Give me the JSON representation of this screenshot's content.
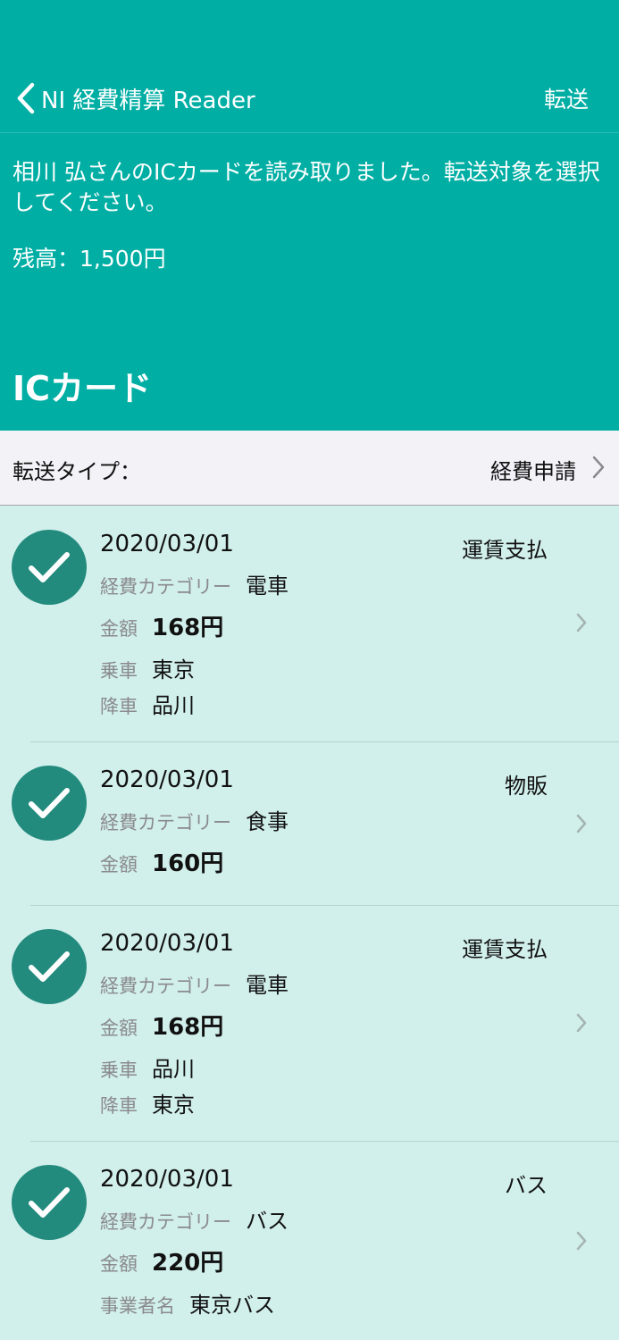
{
  "nav": {
    "back_label": "NI 経費精算 Reader",
    "action_label": "転送"
  },
  "header": {
    "message": "相川 弘さんのICカードを読み取りました。転送対象を選択してください。",
    "balance": "残高：1,500円",
    "section_title": "ICカード"
  },
  "transfer_type": {
    "label": "転送タイプ：",
    "value": "経費申請"
  },
  "items": [
    {
      "date": "2020/03/01",
      "kind": "運賃支払",
      "category_label": "経費カテゴリー",
      "category": "電車",
      "amount_label": "金額",
      "amount": "168円",
      "extra1_label": "乗車",
      "extra1": "東京",
      "extra2_label": "降車",
      "extra2": "品川",
      "selected": true
    },
    {
      "date": "2020/03/01",
      "kind": "物販",
      "category_label": "経費カテゴリー",
      "category": "食事",
      "amount_label": "金額",
      "amount": "160円",
      "selected": true
    },
    {
      "date": "2020/03/01",
      "kind": "運賃支払",
      "category_label": "経費カテゴリー",
      "category": "電車",
      "amount_label": "金額",
      "amount": "168円",
      "extra1_label": "乗車",
      "extra1": "品川",
      "extra2_label": "降車",
      "extra2": "東京",
      "selected": true
    },
    {
      "date": "2020/03/01",
      "kind": "バス",
      "category_label": "経費カテゴリー",
      "category": "バス",
      "amount_label": "金額",
      "amount": "220円",
      "extra1_label": "事業者名",
      "extra1": "東京バス",
      "selected": true
    }
  ],
  "colors": {
    "header_bg": "#00aea4",
    "list_bg": "#d1efeb",
    "check_bg": "#228b7d"
  },
  "icons": {
    "back": "chevron-left-icon",
    "row_chevron": "chevron-right-icon",
    "selected": "checkmark-icon"
  }
}
